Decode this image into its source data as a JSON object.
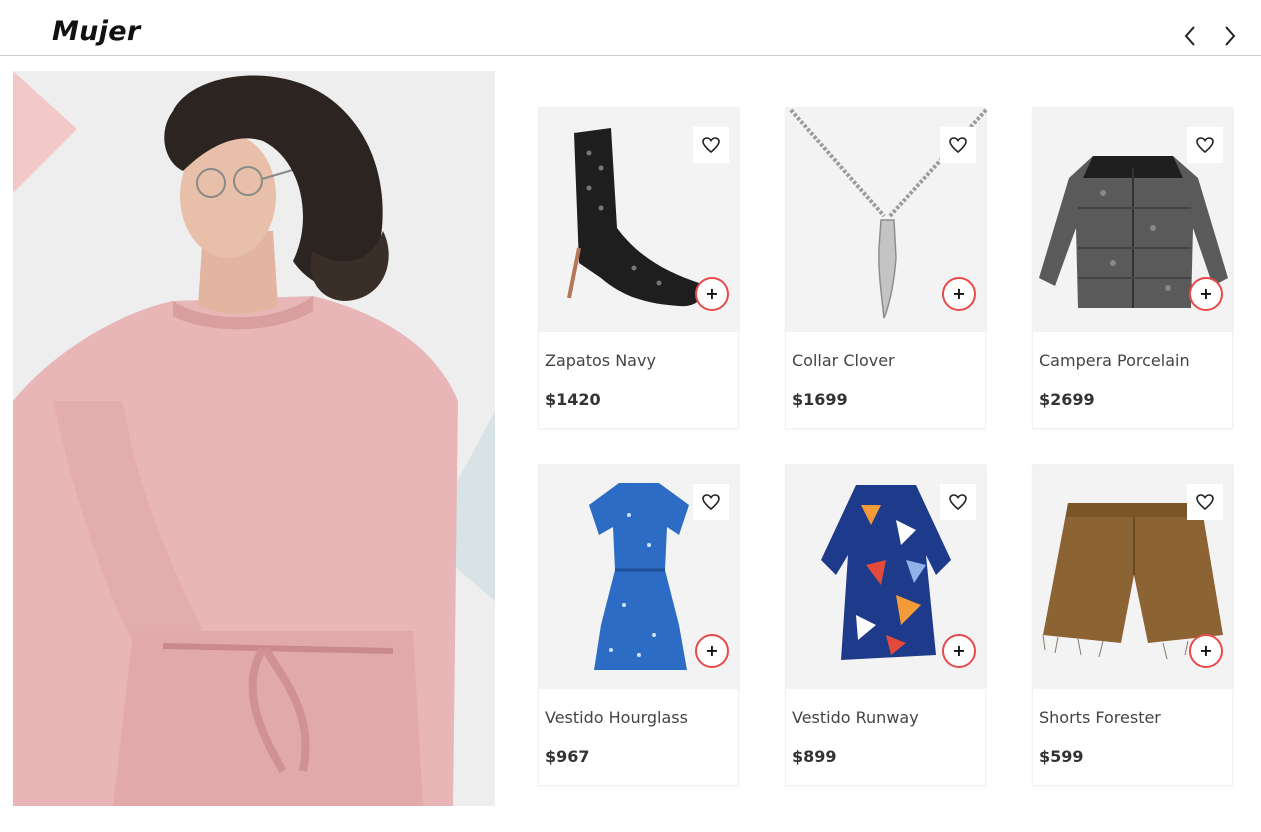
{
  "section": {
    "title": "Mujer",
    "prev_icon": "chevron-left-icon",
    "next_icon": "chevron-right-icon"
  },
  "hero": {
    "subject": "woman-pink-sweater",
    "accent_colors": [
      "#f2c8c8",
      "#d8e3e6"
    ]
  },
  "products": [
    {
      "name": "Zapatos Navy",
      "price": "$1420",
      "add_label": "+",
      "image": "black-heeled-bootie"
    },
    {
      "name": "Collar Clover",
      "price": "$1699",
      "add_label": "+",
      "image": "silver-chain-necklace"
    },
    {
      "name": "Campera Porcelain",
      "price": "$2699",
      "add_label": "+",
      "image": "leopard-puffer-jacket"
    },
    {
      "name": "Vestido Hourglass",
      "price": "$967",
      "add_label": "+",
      "image": "blue-floral-dress"
    },
    {
      "name": "Vestido Runway",
      "price": "$899",
      "add_label": "+",
      "image": "geometric-print-dress"
    },
    {
      "name": "Shorts Forester",
      "price": "$599",
      "add_label": "+",
      "image": "brown-cutoff-shorts"
    }
  ],
  "colors": {
    "add_ring": "#e84a4a",
    "image_bg": "#f3f3f3"
  }
}
